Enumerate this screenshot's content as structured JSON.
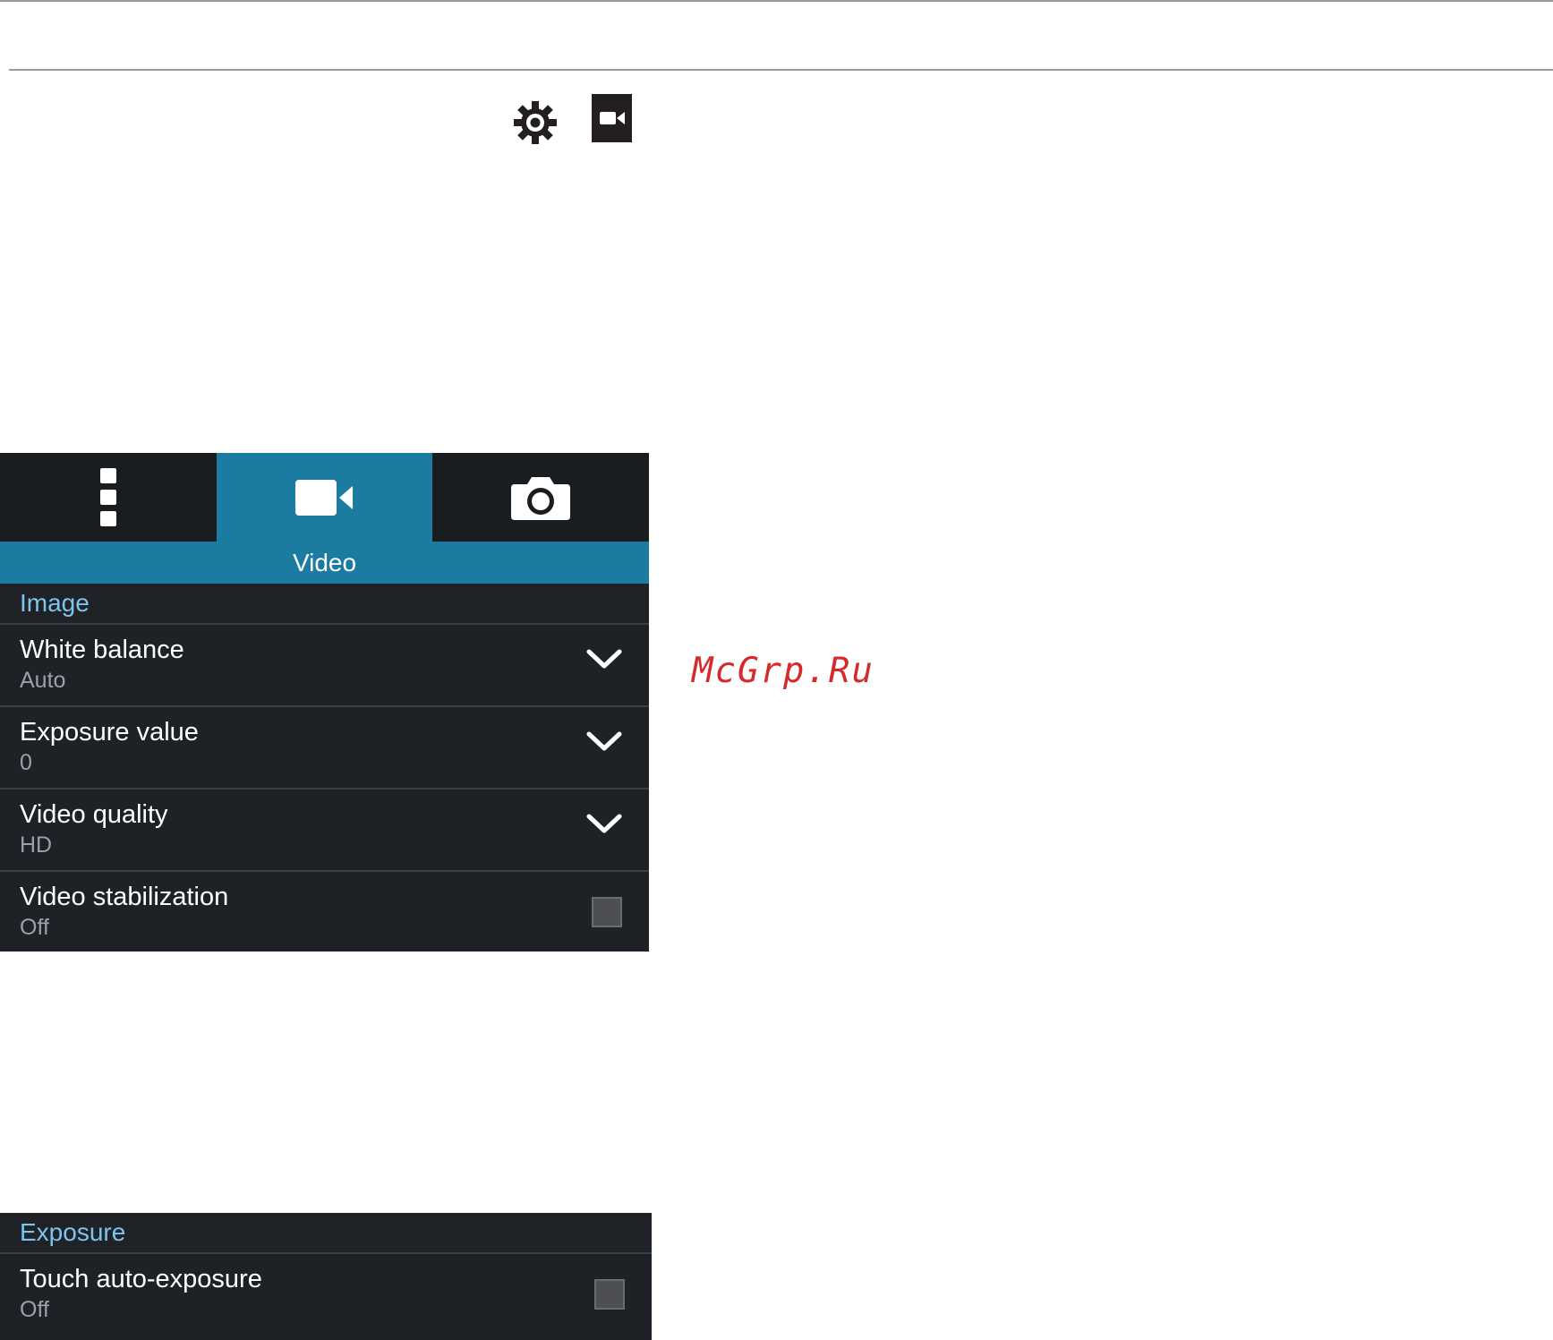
{
  "header_icons": {
    "gear": "gear-icon",
    "video": "video-camera-icon"
  },
  "tabs": [
    {
      "icon": "more-options-icon",
      "active": false
    },
    {
      "icon": "video-camera-icon",
      "active": true
    },
    {
      "icon": "camera-icon",
      "active": false
    }
  ],
  "panel_title": "Video",
  "sections": {
    "image": {
      "header": "Image",
      "rows": [
        {
          "label": "White balance",
          "value": "Auto",
          "control": "dropdown"
        },
        {
          "label": "Exposure value",
          "value": "0",
          "control": "dropdown"
        },
        {
          "label": "Video quality",
          "value": "HD",
          "control": "dropdown"
        },
        {
          "label": "Video stabilization",
          "value": "Off",
          "control": "checkbox",
          "checked": false
        }
      ]
    },
    "exposure": {
      "header": "Exposure",
      "rows": [
        {
          "label": "Touch auto-exposure",
          "value": "Off",
          "control": "checkbox",
          "checked": false
        }
      ]
    }
  },
  "watermark": "McGrp.Ru",
  "colors": {
    "accent": "#1b7ba0",
    "panel_bg": "#1e2226",
    "section_text": "#7cc4ec",
    "watermark": "#d62a2a"
  }
}
